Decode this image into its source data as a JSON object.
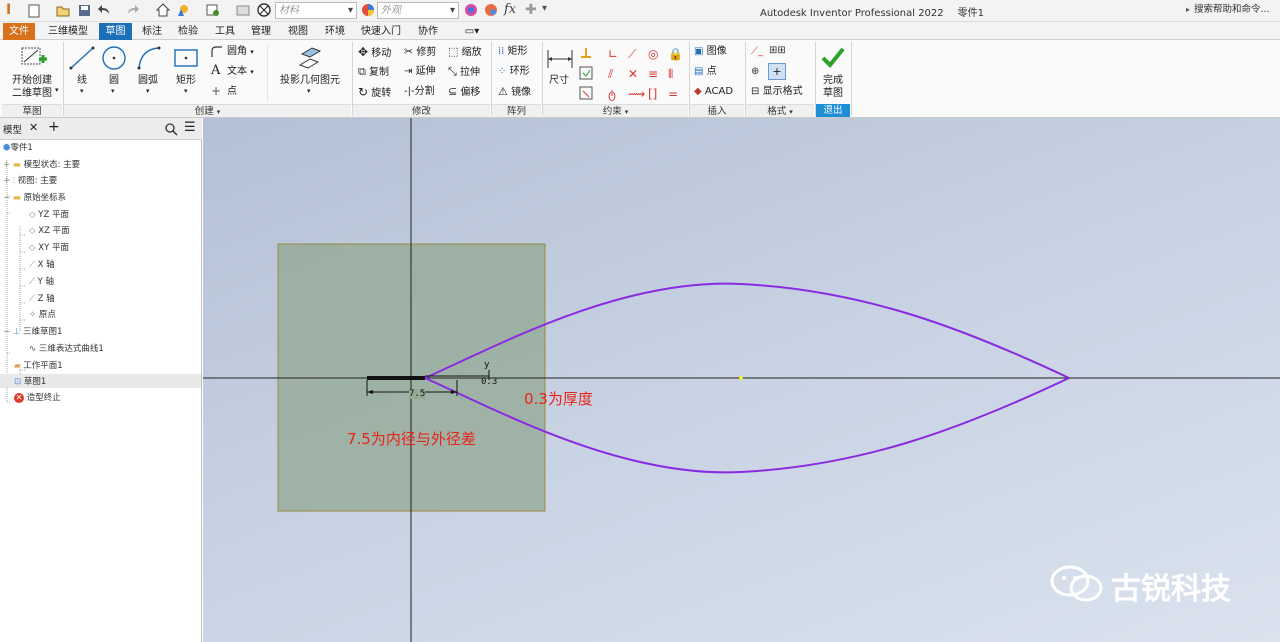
{
  "window": {
    "title": "Autodesk Inventor Professional 2022",
    "document": "零件1",
    "help_search": "搜索帮助和命令..."
  },
  "qat": {
    "material_placeholder": "材料",
    "appearance_placeholder": "外观",
    "fx": "fx"
  },
  "tabs": [
    {
      "label": "文件"
    },
    {
      "label": "三维模型"
    },
    {
      "label": "草图"
    },
    {
      "label": "标注"
    },
    {
      "label": "检验"
    },
    {
      "label": "工具"
    },
    {
      "label": "管理"
    },
    {
      "label": "视图"
    },
    {
      "label": "环境"
    },
    {
      "label": "快速入门"
    },
    {
      "label": "协作"
    }
  ],
  "ribbon": {
    "sketch_panel": {
      "title": "草图",
      "start_line1": "开始创建",
      "start_line2": "二维草图"
    },
    "create_panel": {
      "title": "创建",
      "line": "线",
      "circle": "圆",
      "arc": "圆弧",
      "rect": "矩形",
      "fillet": "圆角",
      "text": "文本",
      "point": "点",
      "project": "投影几何图元"
    },
    "modify_panel": {
      "title": "修改",
      "move": "移动",
      "copy": "复制",
      "rotate": "旋转",
      "trim": "修剪",
      "extend": "延伸",
      "split": "分割",
      "scale": "缩放",
      "stretch": "拉伸",
      "offset": "偏移"
    },
    "pattern_panel": {
      "title": "阵列",
      "rect": "矩形",
      "circular": "环形",
      "mirror": "镜像"
    },
    "constrain_panel": {
      "title": "约束",
      "dimension": "尺寸"
    },
    "insert_panel": {
      "title": "插入",
      "image": "图像",
      "points": "点",
      "acad": "ACAD"
    },
    "format_panel": {
      "title": "格式",
      "show_format": "显示格式"
    },
    "exit_panel": {
      "title": "退出",
      "finish_line1": "完成",
      "finish_line2": "草图"
    }
  },
  "browser": {
    "tab": "模型",
    "items": [
      {
        "label": "零件1"
      },
      {
        "label": "模型状态: 主要"
      },
      {
        "label": "视图: 主要"
      },
      {
        "label": "原始坐标系"
      },
      {
        "label": "YZ 平面"
      },
      {
        "label": "XZ 平面"
      },
      {
        "label": "XY 平面"
      },
      {
        "label": "X 轴"
      },
      {
        "label": "Y 轴"
      },
      {
        "label": "Z 轴"
      },
      {
        "label": "原点"
      },
      {
        "label": "三维草图1"
      },
      {
        "label": "三维表达式曲线1"
      },
      {
        "label": "工作平面1"
      },
      {
        "label": "草图1"
      },
      {
        "label": "造型终止"
      }
    ]
  },
  "canvas": {
    "dim_thickness": "0.3",
    "dim_length": "7.5",
    "dim_y": "y",
    "note_thickness": "0.3为厚度",
    "note_length": "7.5为内径与外径差",
    "watermark": "古锐科技",
    "curve_color": "#8a2be2",
    "note_color": "#e8231a"
  }
}
